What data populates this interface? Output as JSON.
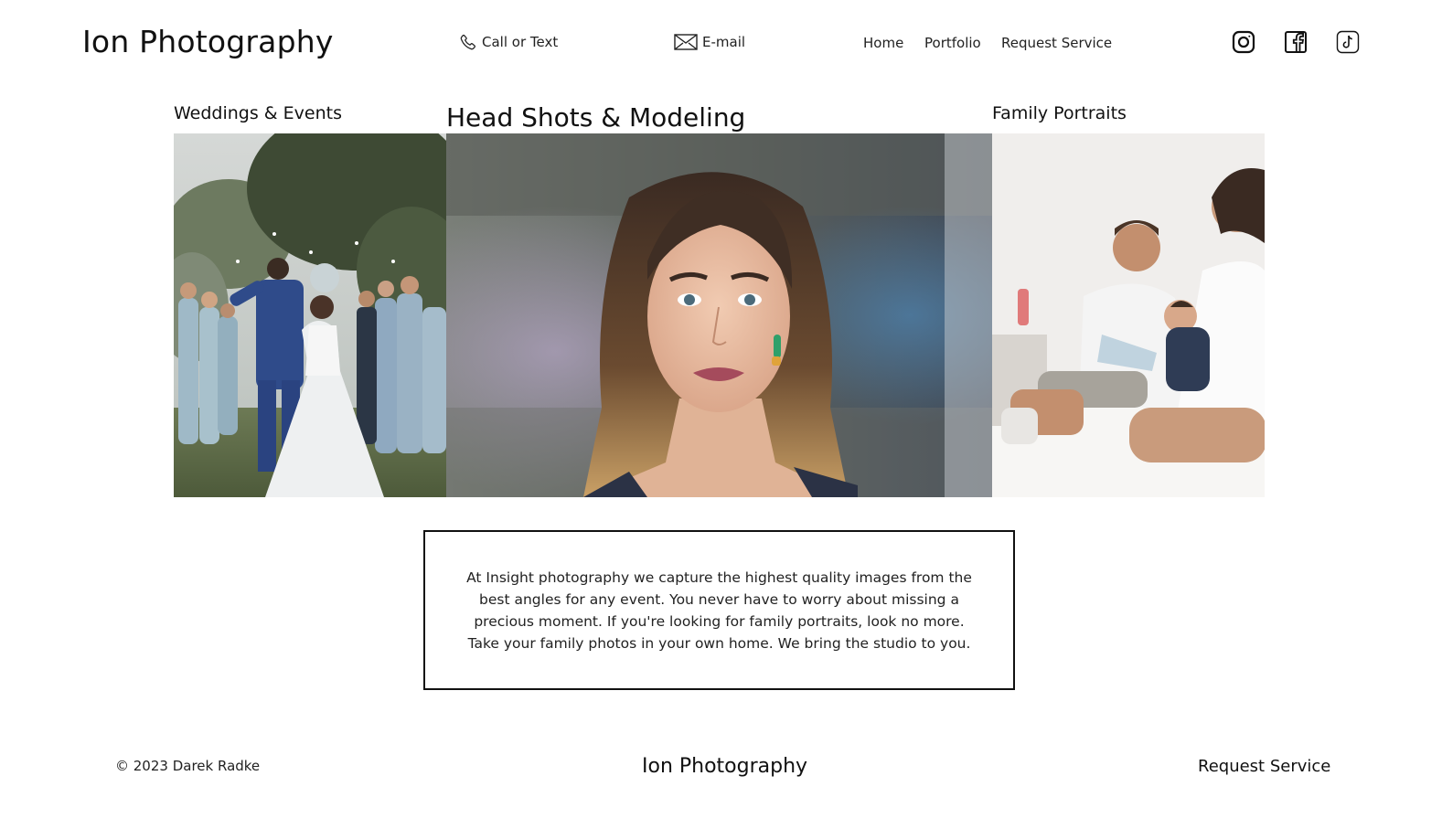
{
  "header": {
    "brand": "Ion Photography",
    "contact": {
      "call_label": "Call or Text",
      "call_icon": "phone-icon",
      "email_label": "E-mail",
      "email_icon": "envelope-icon"
    },
    "nav": [
      "Home",
      "Portfolio",
      "Request Service"
    ],
    "social": [
      {
        "name": "instagram",
        "icon": "instagram-icon"
      },
      {
        "name": "facebook",
        "icon": "facebook-icon"
      },
      {
        "name": "tiktok",
        "icon": "tiktok-icon"
      }
    ]
  },
  "gallery": [
    {
      "label": "Weddings & Events",
      "image": "wedding couple walking through crowd of guests"
    },
    {
      "label": "Head Shots & Modeling",
      "image": "portrait of woman with wavy hair"
    },
    {
      "label": "Family Portraits",
      "image": "family with newborn on bed"
    }
  ],
  "about": {
    "text": "At Insight photography we capture the highest quality images from the best angles for any event. You never have to worry about missing a precious moment. If you're looking for family portraits, look no more. Take your family photos in your own home. We bring the studio to you."
  },
  "footer": {
    "copyright": "© 2023 Darek Radke",
    "brand": "Ion Photography",
    "cta": "Request Service"
  },
  "colors": {
    "text": "#111111",
    "background": "#ffffff",
    "border": "#111111"
  }
}
